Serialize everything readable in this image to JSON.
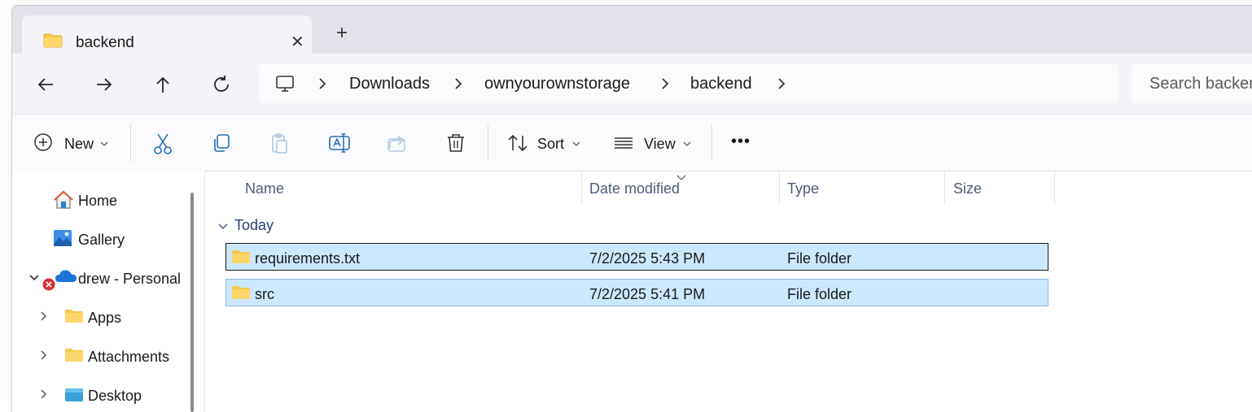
{
  "tab": {
    "title": "backend",
    "close_glyph": "✕",
    "new_tab_glyph": "+"
  },
  "nav": {
    "back_icon": "arrow-left-icon",
    "forward_icon": "arrow-right-icon",
    "up_icon": "arrow-up-icon",
    "refresh_icon": "refresh-icon"
  },
  "breadcrumb": [
    "Downloads",
    "ownyourownstorage",
    "backend"
  ],
  "search": {
    "placeholder": "Search backen"
  },
  "commands": {
    "new_label": "New",
    "sort_label": "Sort",
    "view_label": "View",
    "more_glyph": "•••"
  },
  "sidebar": {
    "items": [
      {
        "label": "Home",
        "icon": "home-icon"
      },
      {
        "label": "Gallery",
        "icon": "gallery-icon"
      },
      {
        "label": "drew - Personal",
        "icon": "onedrive-icon",
        "status": "sync-error"
      },
      {
        "label": "Apps",
        "icon": "folder-icon"
      },
      {
        "label": "Attachments",
        "icon": "folder-icon"
      },
      {
        "label": "Desktop",
        "icon": "desktop-folder-icon"
      }
    ]
  },
  "columns": [
    "Name",
    "Date modified",
    "Type",
    "Size"
  ],
  "group": {
    "label": "Today"
  },
  "files": [
    {
      "name": "requirements.txt",
      "date": "7/2/2025 5:43 PM",
      "type": "File folder",
      "size": ""
    },
    {
      "name": "src",
      "date": "7/2/2025 5:41 PM",
      "type": "File folder",
      "size": ""
    }
  ],
  "colors": {
    "accent": "#0067c0",
    "selection": "#cce8ff",
    "folder": "#f8c84a",
    "error": "#d13438"
  }
}
